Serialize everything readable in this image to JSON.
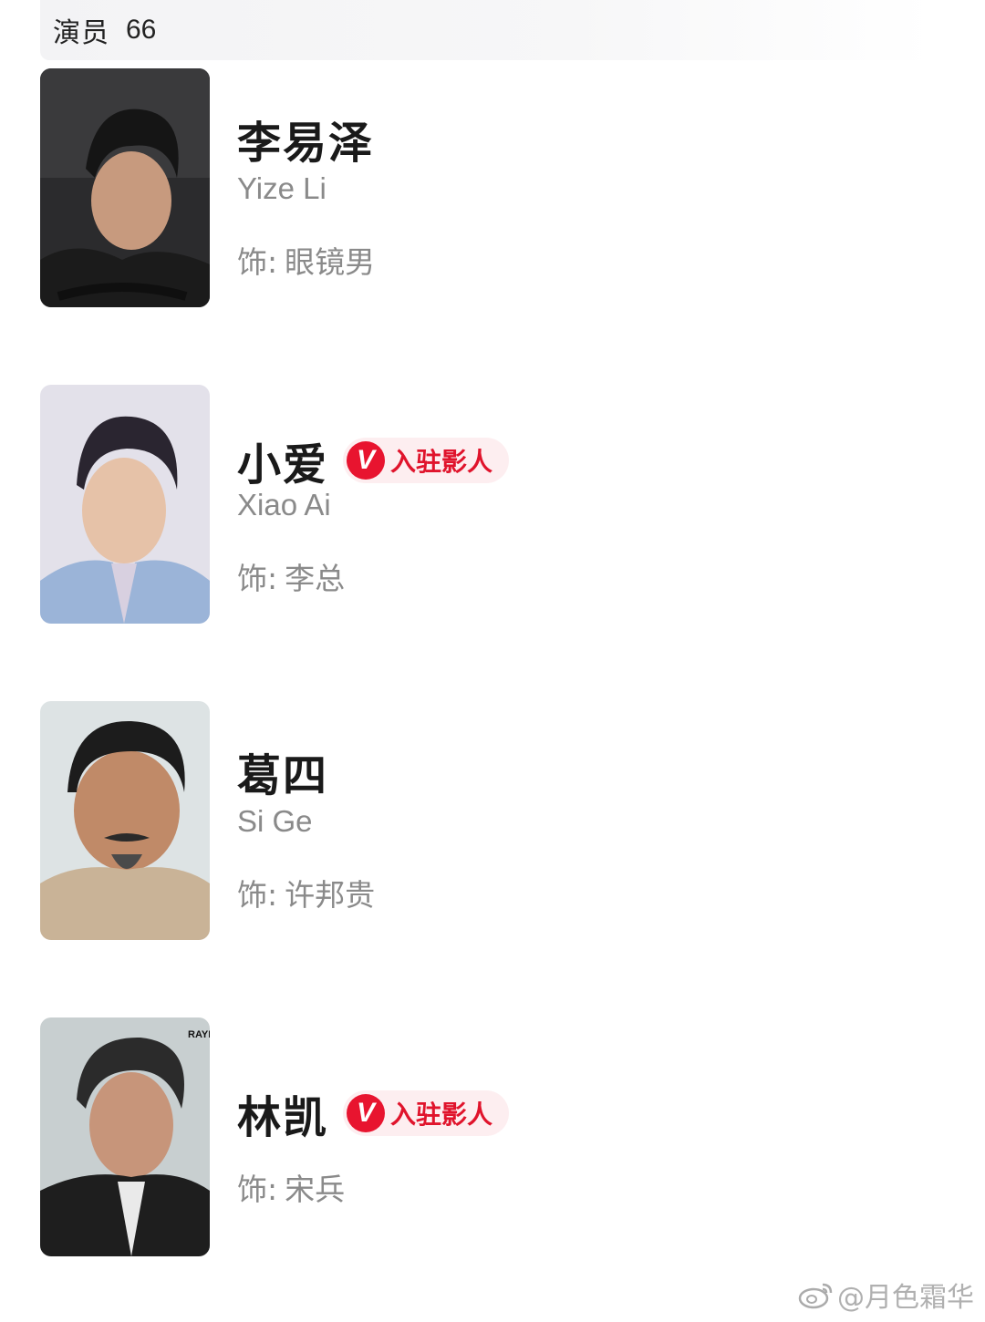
{
  "header": {
    "title": "演员",
    "count": "66"
  },
  "actors": [
    {
      "name": "李易泽",
      "en_name": "Yize Li",
      "role_prefix": "饰:",
      "role_name": "眼镜男",
      "verified": false
    },
    {
      "name": "小爱",
      "en_name": "Xiao Ai",
      "role_prefix": "饰:",
      "role_name": "李总",
      "verified": true,
      "badge_letter": "V",
      "badge_text": "入驻影人"
    },
    {
      "name": "葛四",
      "en_name": "Si Ge",
      "role_prefix": "饰:",
      "role_name": "许邦贵",
      "verified": false
    },
    {
      "name": "林凯",
      "en_name": "",
      "role_prefix": "饰:",
      "role_name": "宋兵",
      "verified": true,
      "badge_letter": "V",
      "badge_text": "入驻影人",
      "photo_corner_text": "RAYI"
    }
  ],
  "watermark": {
    "text": "@月色霜华",
    "icon": "weibo-icon"
  },
  "colors": {
    "badge_red": "#e8142f",
    "badge_bg": "#fdeef0",
    "secondary_text": "#8a8a8a"
  }
}
